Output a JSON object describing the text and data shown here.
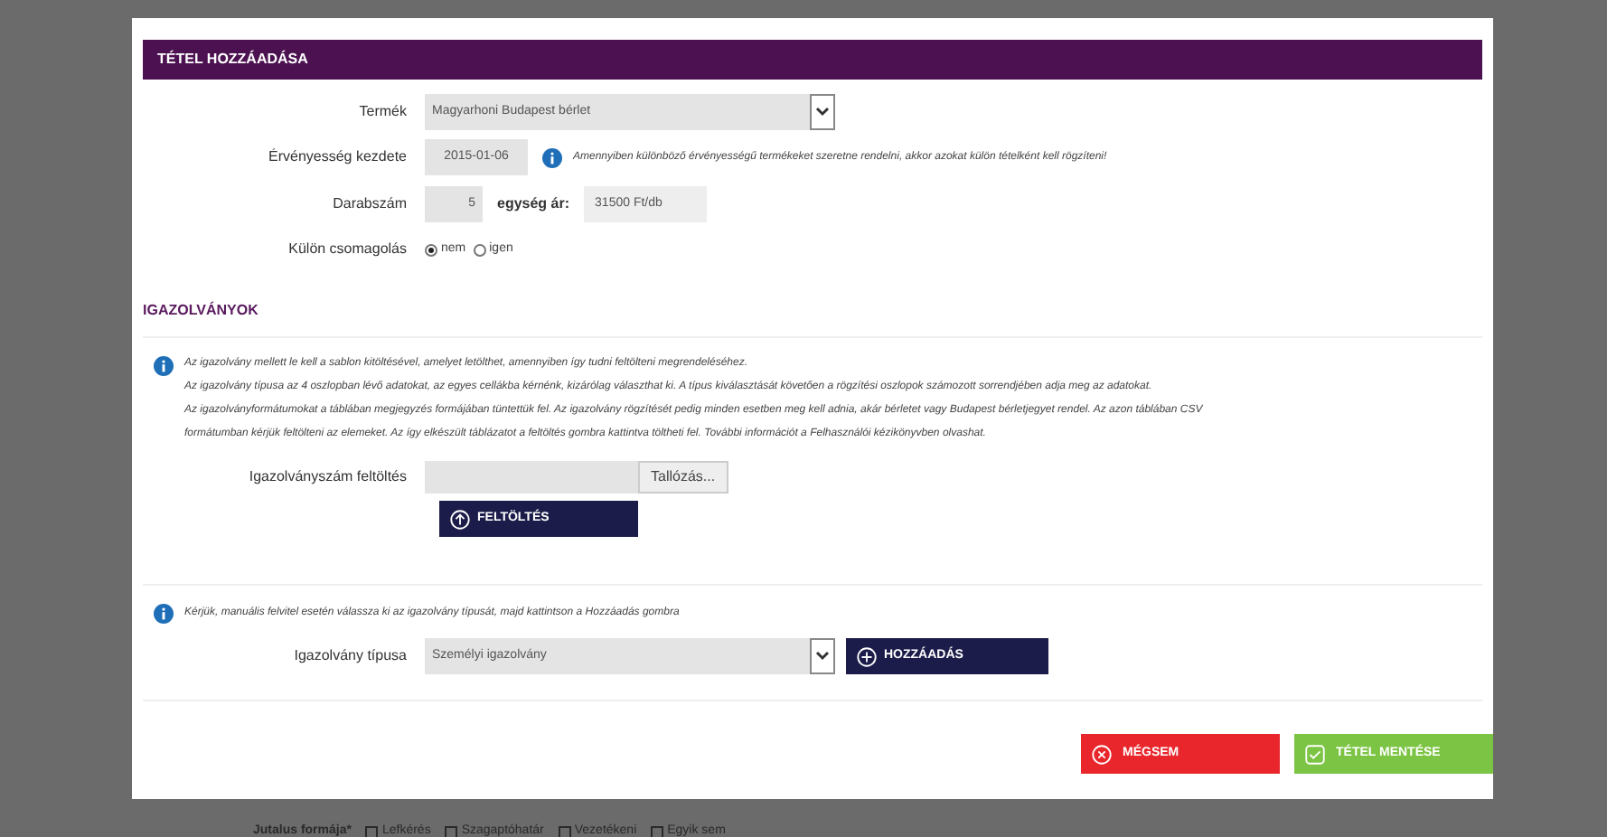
{
  "dialog": {
    "title": "TÉTEL HOZZÁADÁSA",
    "form": [
      {
        "kind": "select",
        "label": "Termék",
        "value": "Magyarhoni Budapest bérlet"
      },
      {
        "kind": "date",
        "label": "Érvényesség kezdete",
        "value": "2015-01-06",
        "note": "Amennyiben különböző érvényességű termékeket szeretne rendelni, akkor azokat külön tételként kell rögzíteni!"
      },
      {
        "kind": "quantity",
        "label": "Darabszám",
        "value": "5",
        "price_label": "egység ár:",
        "price": "31500 Ft/db"
      },
      {
        "kind": "radio",
        "label": "Külön csomagolás",
        "options": [
          {
            "label": "nem",
            "selected": true
          },
          {
            "label": "igen",
            "selected": false
          }
        ]
      }
    ],
    "ids": {
      "heading": "IGAZOLVÁNYOK",
      "info": [
        "Az igazolvány mellett le kell a sablon kitöltésével, amelyet letölthet, amennyiben így tudni feltölteni megrendeléséhez.",
        "Az igazolvány típusa az 4 oszlopban lévő adatokat, az egyes cellákba kérnénk, kizárólag választhat ki. A típus kiválasztását követően a rögzítési oszlopok számozott sorrendjében adja meg az adatokat.",
        "Az igazolványformátumokat a táblában megjegyzés formájában tüntettük fel. Az igazolvány rögzítését pedig minden esetben meg kell adnia, akár bérletet vagy Budapest bérletjegyet rendel. Az azon táblában CSV",
        "formátumban kérjük feltölteni az elemeket. Az így elkészült táblázatot a feltöltés gombra kattintva töltheti fel. További információt a Felhasználói kézikönyvben olvashat."
      ],
      "upload_label": "Igazolványszám feltöltés",
      "browse": "Tallózás...",
      "upload_button": "FELTÖLTÉS",
      "hint": "Kérjük, manuális felvitel esetén válassza ki az igazolvány típusát, majd kattintson a Hozzáadás gombra",
      "type_label": "Igazolvány típusa",
      "type_value": "Személyi igazolvány",
      "add_button": "HOZZÁADÁS"
    },
    "buttons": [
      {
        "kind": "cancel",
        "label": "MÉGSEM"
      },
      {
        "kind": "save",
        "label": "TÉTEL MENTÉSE"
      }
    ]
  },
  "background": {
    "label": "Jutalus formája*",
    "options": [
      {
        "label": "Lefkérés",
        "checked": false
      },
      {
        "label": "Szagaptóhatár",
        "checked": false
      },
      {
        "label": "Vezetékeni",
        "checked": false
      },
      {
        "label": "Egyik sem",
        "checked": false
      }
    ]
  }
}
